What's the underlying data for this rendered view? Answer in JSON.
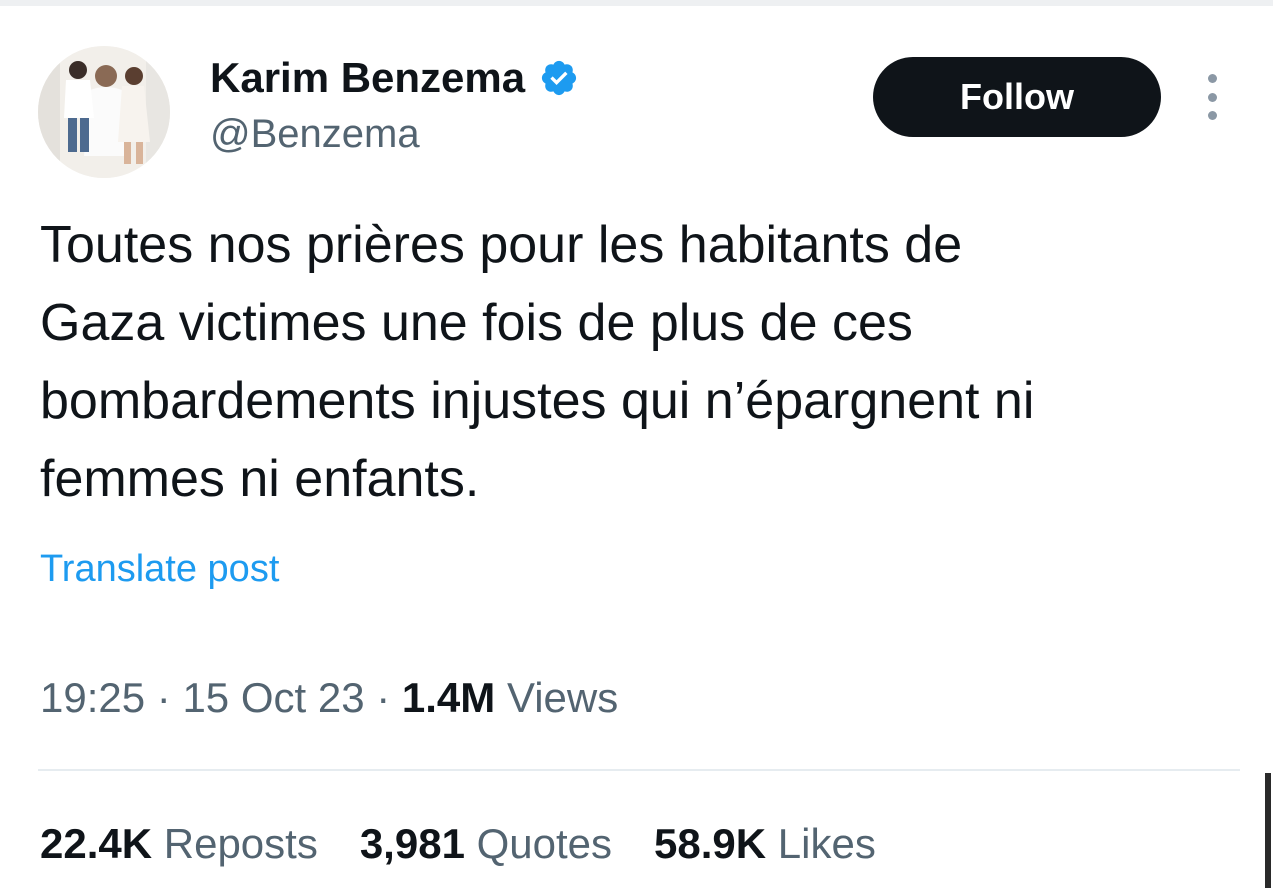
{
  "author": {
    "display_name": "Karim Benzema",
    "handle": "@Benzema",
    "verified": true,
    "verified_color": "#1d9bf0"
  },
  "actions": {
    "follow_label": "Follow",
    "more_icon": "more-vertical-icon"
  },
  "post": {
    "text_lines": [
      "Toutes nos prières pour les habitants de",
      "Gaza victimes une fois de plus de ces",
      "bombardements injustes qui n’épargnent ni",
      "femmes ni enfants."
    ],
    "translate_label": "Translate post"
  },
  "meta": {
    "time": "19:25",
    "separator": "·",
    "date": "15 Oct 23",
    "views_count": "1.4M",
    "views_label": "Views"
  },
  "stats": {
    "reposts_count": "22.4K",
    "reposts_label": "Reposts",
    "quotes_count": "3,981",
    "quotes_label": "Quotes",
    "likes_count": "58.9K",
    "likes_label": "Likes"
  },
  "colors": {
    "accent": "#1d9bf0",
    "text_primary": "#0f1419",
    "text_secondary": "#536471",
    "button_bg": "#0f1419"
  }
}
